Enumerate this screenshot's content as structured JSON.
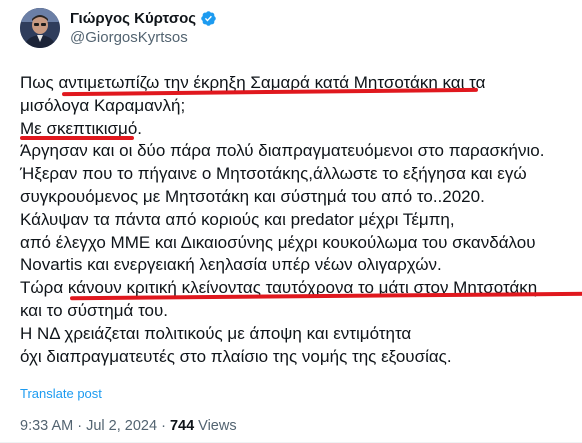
{
  "author": {
    "display_name": "Γιώργος Κύρτσος",
    "handle": "@GiorgosKyrtsos",
    "verified_badge_color": "#1d9bf0",
    "avatar_icon": "profile-photo"
  },
  "tweet": {
    "lines": [
      "Πως αντιμετωπίζω την έκρηξη Σαμαρά κατά Μητσοτάκη και τα",
      "μισόλογα Καραμανλή;",
      "Με σκεπτικισμό.",
      "Άργησαν και οι δύο πάρα πολύ διαπραγματευόμενοι στο παρασκήνιο.",
      "Ήξεραν που το πήγαινε ο Μητσοτάκης,άλλωστε το εξήγησα και εγώ",
      "συγκρουόμενος με Μητσοτάκη και σύστημά του από το..2020.",
      "Κάλυψαν τα πάντα από κοριούς και predator μέχρι Τέμπη,",
      "από έλεγχο ΜΜΕ και Δικαιοσύνης μέχρι κουκούλωμα του σκανδάλου",
      "Novartis και ενεργειακή λεηλασία υπέρ νέων ολιγαρχών.",
      "Τώρα κάνουν κριτική κλείνοντας ταυτόχρονα το μάτι στον Μητσοτάκη",
      "και το σύστημά του.",
      "Η ΝΔ χρειάζεται πολιτικούς με άποψη και εντιμότητα",
      "όχι διαπραγματευτές στο πλαίσιο της νομής της εξουσίας."
    ],
    "highlight_color": "#e0181e"
  },
  "translate_label": "Translate post",
  "meta": {
    "time": "9:33 AM",
    "separator": " · ",
    "date": "Jul 2, 2024",
    "separator2": " · ",
    "views_count": "744",
    "views_label": " Views"
  }
}
